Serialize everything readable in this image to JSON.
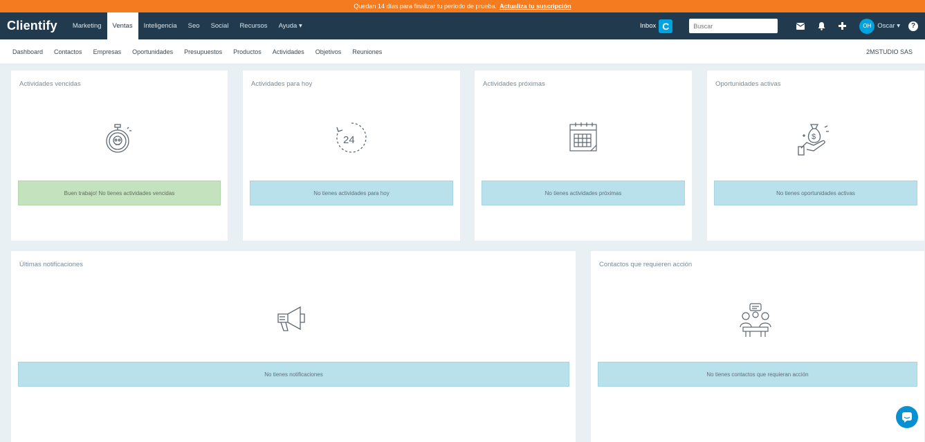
{
  "trial": {
    "text": "Quedan 14 días para finalizar tu período de prueba.",
    "link": "Actualiza tu suscripción"
  },
  "topnav": {
    "logo": "Clientify",
    "items": [
      "Marketing",
      "Ventas",
      "Inteligencia",
      "Seo",
      "Social",
      "Recursos",
      "Ayuda ▾"
    ],
    "active_index": 1,
    "inbox_label": "Inbox",
    "inbox_badge": "C",
    "search_placeholder": "Buscar",
    "avatar_initials": "OH",
    "user_name": "Oscar ▾",
    "help_label": "?"
  },
  "subnav": {
    "items": [
      "Dashboard",
      "Contactos",
      "Empresas",
      "Oportunidades",
      "Presupuestos",
      "Productos",
      "Actividades",
      "Objetivos",
      "Reuniones"
    ],
    "company": "2MSTUDIO SAS"
  },
  "cards": {
    "overdue": {
      "title": "Actividades vencidas",
      "message": "Buen trabajo! No tienes actividades vencidas"
    },
    "today": {
      "title": "Actividades para hoy",
      "message": "No tienes actividades para hoy"
    },
    "upcoming": {
      "title": "Actividades próximas",
      "message": "No tienes actividades próximas"
    },
    "opportunities": {
      "title": "Oportunidades activas",
      "message": "No tienes oportunidades activas"
    },
    "notifications": {
      "title": "Últimas notificaciones",
      "message": "No tienes notificaciones"
    },
    "contacts": {
      "title": "Contactos que requieren acción",
      "message": "No tienes contactos que requieran acción"
    }
  },
  "icons": {
    "overdue": "stopwatch-skull-icon",
    "today": "clock-24-icon",
    "upcoming": "calendar-icon",
    "opportunities": "money-bag-hand-icon",
    "notifications": "megaphone-icon",
    "contacts": "meeting-people-icon",
    "chat": "chat-bubble-icon"
  },
  "colors": {
    "trial_bar": "#f47b20",
    "topnav": "#213a4e",
    "accent": "#00a3e0",
    "info_box": "#b9e1ec",
    "success_box": "#c5e2be"
  }
}
